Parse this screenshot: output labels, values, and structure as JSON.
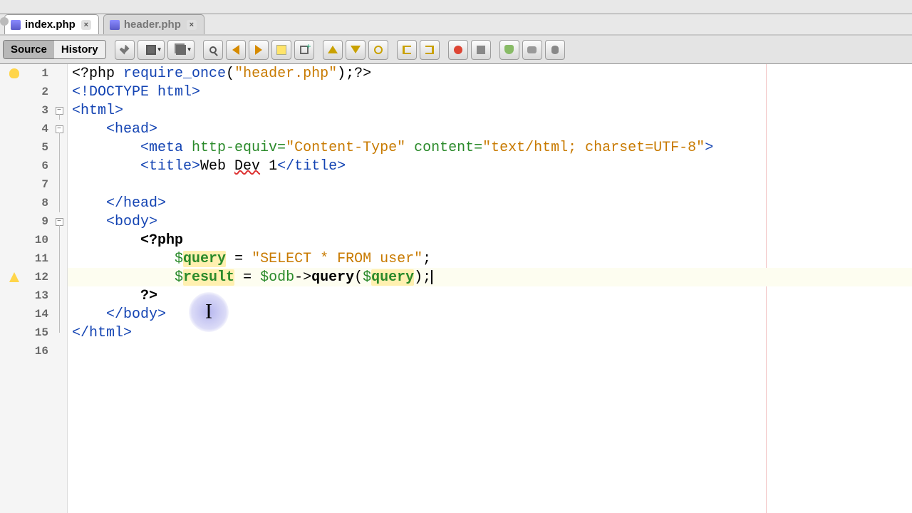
{
  "tabs": [
    {
      "label": "index.php",
      "active": true
    },
    {
      "label": "header.php",
      "active": false
    }
  ],
  "viewmode": {
    "source": "Source",
    "history": "History"
  },
  "lines": {
    "n1": "1",
    "n2": "2",
    "n3": "3",
    "n4": "4",
    "n5": "5",
    "n6": "6",
    "n7": "7",
    "n8": "8",
    "n9": "9",
    "n10": "10",
    "n11": "11",
    "n12": "12",
    "n13": "13",
    "n14": "14",
    "n15": "15",
    "n16": "16"
  },
  "code": {
    "l1_open": "<?php ",
    "l1_req": "require_once",
    "l1_paren1": "(",
    "l1_str": "\"header.php\"",
    "l1_paren2": ")",
    "l1_close": ";?>",
    "l2": "<!DOCTYPE html>",
    "l3": "<html>",
    "l4_pad": "    ",
    "l4": "<head>",
    "l5_pad": "        ",
    "l5_a": "<meta ",
    "l5_b": "http-equiv=",
    "l5_c": "\"Content-Type\"",
    "l5_d": " content=",
    "l5_e": "\"text/html; charset=UTF-8\"",
    "l5_f": ">",
    "l6_pad": "        ",
    "l6_a": "<title>",
    "l6_b": "Web ",
    "l6_c": "Dev",
    "l6_d": " 1",
    "l6_e": "</title>",
    "l8_pad": "    ",
    "l8": "</head>",
    "l9_pad": "    ",
    "l9": "<body>",
    "l10_pad": "        ",
    "l10": "<?php",
    "l11_pad": "            ",
    "l11_a": "$",
    "l11_b": "query",
    "l11_c": " = ",
    "l11_d": "\"SELECT * FROM user\"",
    "l11_e": ";",
    "l12_pad": "            ",
    "l12_a": "$",
    "l12_b": "result",
    "l12_c": " = ",
    "l12_d": "$odb",
    "l12_e": "->",
    "l12_f": "query",
    "l12_g": "(",
    "l12_h": "$",
    "l12_i": "query",
    "l12_j": ");",
    "l13_pad": "        ",
    "l13": "?>",
    "l14_pad": "    ",
    "l14": "</body>",
    "l15": "</html>"
  },
  "fold": {
    "minus": "−"
  }
}
